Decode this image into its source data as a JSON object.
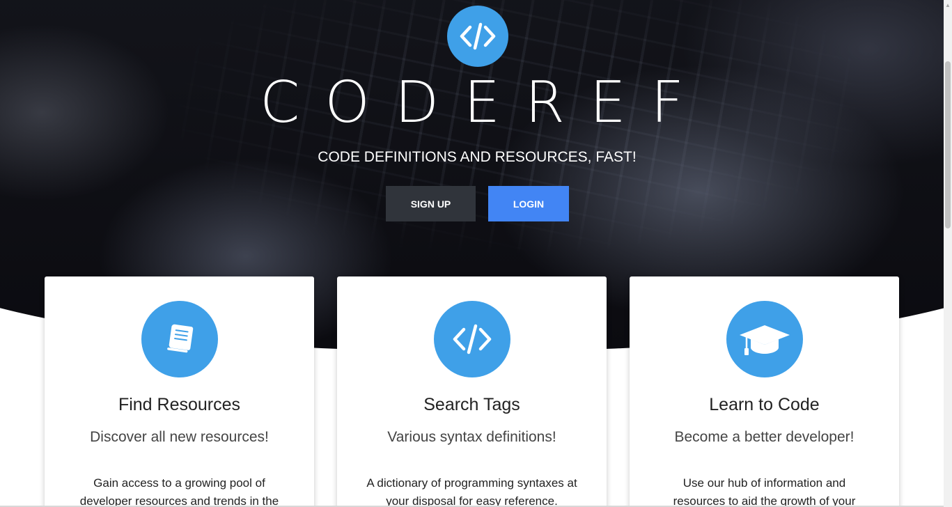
{
  "hero": {
    "brand": "CODEREF",
    "tagline": "CODE DEFINITIONS AND RESOURCES, FAST!",
    "logo_icon": "code-brackets-icon",
    "signup_label": "SIGN UP",
    "login_label": "LOGIN"
  },
  "colors": {
    "accent": "#3fa0e8",
    "login": "#4285f4",
    "signup": "#30343b",
    "hero_dark": "#121319"
  },
  "cards": [
    {
      "icon": "book-icon",
      "title": "Find Resources",
      "subtitle": "Discover all new resources!",
      "body": "Gain access to a growing pool of developer resources and trends in the"
    },
    {
      "icon": "code-brackets-icon",
      "title": "Search Tags",
      "subtitle": "Various syntax definitions!",
      "body": "A dictionary of programming syntaxes at your disposal for easy reference."
    },
    {
      "icon": "graduation-cap-icon",
      "title": "Learn to Code",
      "subtitle": "Become a better developer!",
      "body": "Use our hub of information and resources to aid the growth of your"
    }
  ]
}
